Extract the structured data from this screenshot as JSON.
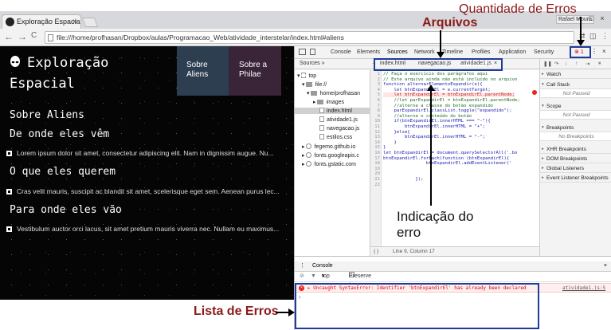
{
  "browser": {
    "tab_title": "Exploração Espacial",
    "tab_close": "×",
    "profile": "Rafael Moura",
    "address": "file:///home/profhasan/Dropbox/aulas/Programacao_Web/atividade_interstelar/index.html#aliens",
    "back": "←",
    "forward": "→",
    "reload": "C"
  },
  "page": {
    "logo": "Exploração Espacial",
    "nav": [
      {
        "label": "Sobre Aliens",
        "color": "#2d3e50"
      },
      {
        "label": "Sobre a Philae",
        "color": "#3a2438"
      }
    ],
    "heading": "Sobre Aliens",
    "sections": [
      {
        "title": "De onde eles vêm",
        "text": "Lorem ipsum dolor sit amet, consectetur adipiscing elit. Nam in dignissim augue. Nu..."
      },
      {
        "title": "O que eles querem",
        "text": "Cras velit mauris, suscipit ac blandit sit amet, scelerisque eget sem. Aenean purus lec..."
      },
      {
        "title": "Para onde eles vão",
        "text": "Vestibulum auctor orci lacus, sit amet pretium mauris viverra nec. Nullam eu maximus..."
      }
    ]
  },
  "devtools": {
    "tabs": [
      "Console",
      "Elements",
      "Sources",
      "Network",
      "Timeline",
      "Profiles",
      "Application",
      "Security"
    ],
    "active_tab": "Sources",
    "error_count": "1",
    "sources_label": "Sources",
    "tree": [
      "top",
      "file://",
      "home/profhasan",
      "images",
      "index.html",
      "atividade1.js",
      "navegacao.js",
      "estilos.css",
      "fegemo.github.io",
      "fonts.googleapis.c",
      "fonts.gstatic.com"
    ],
    "file_tabs": [
      "index.html",
      "navegacao.js",
      "atividade1.js"
    ],
    "active_file": "atividade1.js",
    "code": [
      {
        "n": "1",
        "t": "// Faça o exercício dos parágrafos aqui",
        "c": "cmt"
      },
      {
        "n": "2",
        "t": "// Este arquivo ainda não está incluído no arquivo",
        "c": "cmt"
      },
      {
        "n": "3",
        "t": "function alternarElementoExpandir(e){",
        "c": "code"
      },
      {
        "n": "4",
        "t": "    let btnExpandirEl = e.currentTarget;",
        "c": "code"
      },
      {
        "n": "5",
        "t": "    let btnExpandirEl = btnExpandirEl.parentNode;",
        "c": "str"
      },
      {
        "n": "6",
        "t": "    //let parExpandirEl = btnExpandirEl.parentNode;",
        "c": "cmt"
      },
      {
        "n": "7",
        "t": "    //alterna a classe do botão expandido",
        "c": "cmt"
      },
      {
        "n": "8",
        "t": "    parExpandirEl.classList.toggle(\"expandido\");",
        "c": "code"
      },
      {
        "n": "9",
        "t": "    //alterna o conteúdo do botão",
        "c": "cmt"
      },
      {
        "n": "10",
        "t": "    if(btnExpandirEl.innerHTML === \"-\"){",
        "c": "code"
      },
      {
        "n": "11",
        "t": "        btnExpandirEl.innerHTML = \"+\";",
        "c": "code"
      },
      {
        "n": "12",
        "t": "    }else{",
        "c": "code"
      },
      {
        "n": "13",
        "t": "        btnExpandirEl.innerHTML = \"-\";",
        "c": "code"
      },
      {
        "n": "14",
        "t": "    }",
        "c": "code"
      },
      {
        "n": "15",
        "t": "}",
        "c": "code"
      },
      {
        "n": "16",
        "t": "let btnExpandirEl = document.querySelectorAll('.bo",
        "c": "code"
      },
      {
        "n": "17",
        "t": "btnExpandirEl.forEach(function (btnExpandirEl){",
        "c": "code"
      },
      {
        "n": "18",
        "t": "                btnExpandirEl.addEventListener('",
        "c": "code"
      },
      {
        "n": "19",
        "t": "",
        "c": "code"
      },
      {
        "n": "20",
        "t": "",
        "c": "code"
      },
      {
        "n": "21",
        "t": "            });",
        "c": "code"
      },
      {
        "n": "22",
        "t": "",
        "c": "code"
      }
    ],
    "status": "Line 9, Column 17",
    "right_pane": {
      "watch": "Watch",
      "call_stack": "Call Stack",
      "call_stack_value": "Not Paused",
      "scope": "Scope",
      "scope_value": "Not Paused",
      "breakpoints": "Breakpoints",
      "breakpoints_value": "No Breakpoints",
      "xhr": "XHR Breakpoints",
      "dom": "DOM Breakpoints",
      "global": "Global Listeners",
      "event": "Event Listener Breakpoints"
    },
    "console": {
      "title": "Console",
      "context": "top",
      "preserve": "Preserve log",
      "error": "Uncaught SyntaxError: Identifier 'btnExpandirEl' has already been declared",
      "error_src": "atividade1.js:5",
      "prompt": "›"
    }
  },
  "annotations": {
    "quantidade": "Quantidade de Erros",
    "arquivos": "Arquivos",
    "indicacao": "Indicação do erro",
    "lista": "Lista de Erros"
  }
}
